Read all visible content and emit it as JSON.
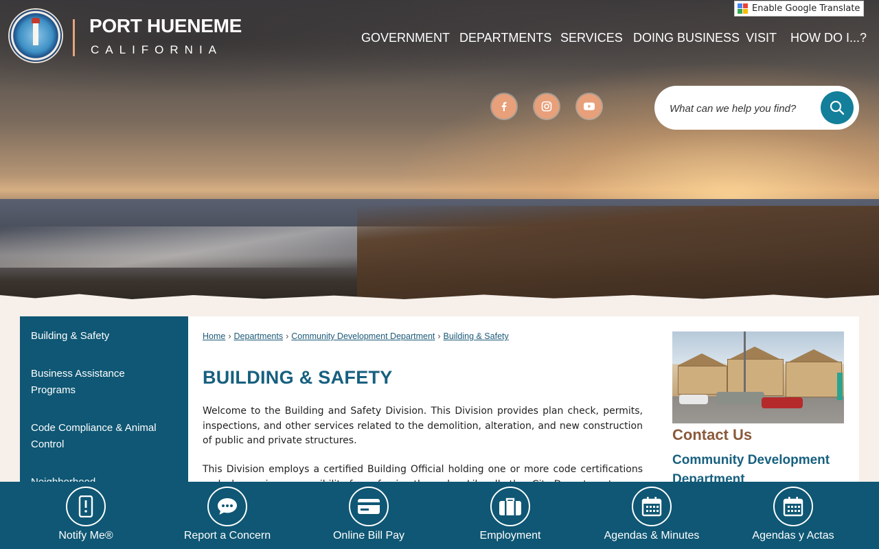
{
  "header": {
    "brand_name": "PORT HUENEME",
    "brand_state": "CALIFORNIA",
    "translate_label": "Enable Google Translate",
    "nav": [
      "GOVERNMENT",
      "DEPARTMENTS",
      "SERVICES",
      "DOING BUSINESS",
      "VISIT",
      "HOW DO I...?"
    ],
    "social": [
      "facebook-icon",
      "instagram-icon",
      "youtube-icon"
    ],
    "search_placeholder": "What can we help you find?"
  },
  "sidebar": {
    "items": [
      "Building & Safety",
      "Business Assistance Programs",
      "Code Compliance & Animal Control",
      "Neighborhood"
    ]
  },
  "main": {
    "breadcrumb": [
      "Home",
      "Departments",
      "Community Development Department",
      "Building & Safety"
    ],
    "title": "BUILDING & SAFETY",
    "paragraphs": [
      "Welcome to the Building and Safety Division. This Division provides plan check, permits, inspections, and other services related to the demolition, alteration, and new construction of public and private structures.",
      "This Division employs a certified Building Official holding one or more code certifications and who carries responsibility for enforcing the codes. Like all other City Departments,"
    ],
    "contact_heading": "Contact Us",
    "contact_dept": "Community Development Department"
  },
  "quick_links": [
    {
      "label": "Notify Me®",
      "icon": "phone-alert-icon"
    },
    {
      "label": "Report a Concern",
      "icon": "chat-bubble-icon"
    },
    {
      "label": "Online Bill Pay",
      "icon": "credit-card-icon"
    },
    {
      "label": "Employment",
      "icon": "briefcase-icon"
    },
    {
      "label": "Agendas & Minutes",
      "icon": "calendar-icon"
    },
    {
      "label": "Agendas y Actas",
      "icon": "calendar-icon"
    }
  ],
  "colors": {
    "primary": "#0f5774",
    "accent": "#e8a07a",
    "heading": "#17607f",
    "contact_heading": "#8a5a3a"
  }
}
